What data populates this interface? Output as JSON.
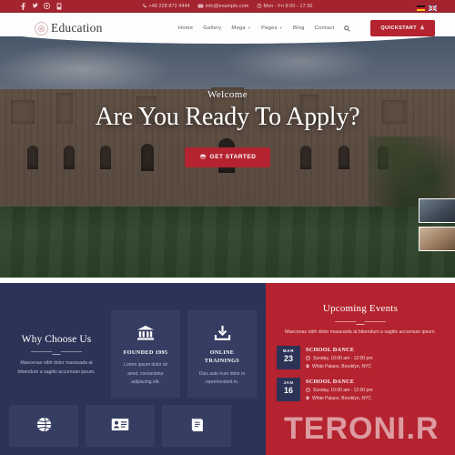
{
  "topbar": {
    "social": [
      {
        "name": "facebook-icon",
        "glyph": "f"
      },
      {
        "name": "twitter-icon",
        "glyph": "✇"
      },
      {
        "name": "google-plus-icon",
        "glyph": "◎"
      },
      {
        "name": "pinterest-icon",
        "glyph": "⌂"
      }
    ],
    "phone": "+49 228 872 4444",
    "email": "info@example.com",
    "hours": "Mon - Fri 8:00 - 17:30",
    "languages": [
      "de",
      "en"
    ],
    "bg_color": "#a3242f"
  },
  "nav": {
    "logo_text": "Education",
    "items": [
      {
        "label": "Home",
        "caret": false
      },
      {
        "label": "Gallery",
        "caret": false
      },
      {
        "label": "Mega",
        "caret": true
      },
      {
        "label": "Pages",
        "caret": true
      },
      {
        "label": "Blog",
        "caret": false
      },
      {
        "label": "Contact",
        "caret": false
      }
    ],
    "quickstart_label": "QUICKSTART",
    "accent_color": "#b4232f"
  },
  "hero": {
    "eyebrow": "Welcome",
    "headline": "Are You Ready To Apply?",
    "cta_label": "GET STARTED",
    "thumbnails": [
      "hero-thumbnail-1",
      "hero-thumbnail-2"
    ]
  },
  "why": {
    "title": "Why Choose Us",
    "description": "Maecenas nibh dolor massuada at bibendum a sagitis accumsan ipsum.",
    "panel_color": "#2c3356",
    "cards": [
      {
        "icon": "bank-icon",
        "title": "FOUNDED 1995",
        "text": "Lorem ipsum dolor sit amet, consectetur adipiscing elit."
      },
      {
        "icon": "download-icon",
        "title": "ONLINE TRAININGS",
        "text": "Duis aute irure dolor in reprehenderit in."
      }
    ],
    "cards_row2": [
      {
        "icon": "globe-icon"
      },
      {
        "icon": "id-card-icon"
      },
      {
        "icon": "book-icon"
      }
    ]
  },
  "events": {
    "title": "Upcoming Events",
    "description": "Maecenas nibh dolor massuada at bibendum a sagitis accumsan ipsum.",
    "panel_color": "#b4232f",
    "items": [
      {
        "month": "MAR",
        "day": "23",
        "name": "SCHOOL DANCE",
        "time": "Sunday, 10:00 am - 12:00 pm",
        "location": "White Palace, Brooklyn, NYC"
      },
      {
        "month": "JAN",
        "day": "16",
        "name": "SCHOOL DANCE",
        "time": "Sunday, 10:00 am - 12:00 pm",
        "location": "White Palace, Brooklyn, NYC"
      }
    ]
  },
  "watermark": {
    "text": "TERONI.R"
  }
}
